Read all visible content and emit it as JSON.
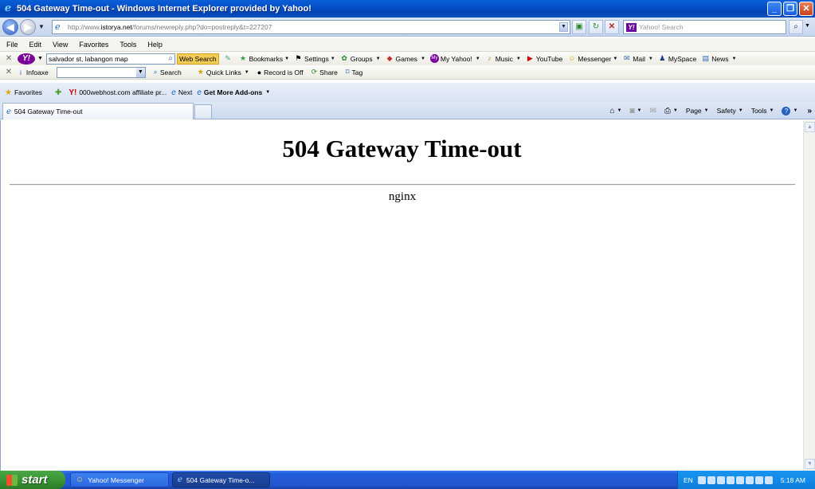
{
  "window": {
    "title": "504 Gateway Time-out - Windows Internet Explorer provided by Yahoo!",
    "buttons": {
      "minimize": "_",
      "restore": "❐",
      "close": "✕"
    }
  },
  "address_bar": {
    "url_prefix": "http://www.",
    "url_domain": "istorya.net",
    "url_path": "/forums/newreply.php?do=postreply&t=227207",
    "search_placeholder": "Yahoo! Search"
  },
  "menu": [
    "File",
    "Edit",
    "View",
    "Favorites",
    "Tools",
    "Help"
  ],
  "yahoo_toolbar": {
    "search_value": "salvador st, labangon map",
    "web_search_label": "Web Search",
    "items": {
      "bookmarks": "Bookmarks",
      "settings": "Settings",
      "groups": "Groups",
      "games": "Games",
      "my_yahoo": "My Yahoo!",
      "music": "Music",
      "youtube": "YouTube",
      "messenger": "Messenger",
      "mail": "Mail",
      "myspace": "MySpace",
      "news": "News"
    }
  },
  "infoaxe_toolbar": {
    "name": "Infoaxe",
    "search_label": "Search",
    "quick_links": "Quick Links",
    "record_status": "Record is Off",
    "share": "Share",
    "tag": "Tag"
  },
  "favorites_bar": {
    "favorites_label": "Favorites",
    "link1": "000webhost.com affiliate pr...",
    "next_label": "Next",
    "addons_label": "Get More Add-ons"
  },
  "tabs": [
    {
      "label": "504 Gateway Time-out"
    }
  ],
  "command_bar": {
    "page": "Page",
    "safety": "Safety",
    "tools": "Tools"
  },
  "page": {
    "heading": "504 Gateway Time-out",
    "server": "nginx"
  },
  "taskbar": {
    "start_label": "start",
    "items": [
      "Yahoo! Messenger",
      "504 Gateway Time-o..."
    ],
    "language": "EN",
    "clock": "5:18 AM"
  }
}
